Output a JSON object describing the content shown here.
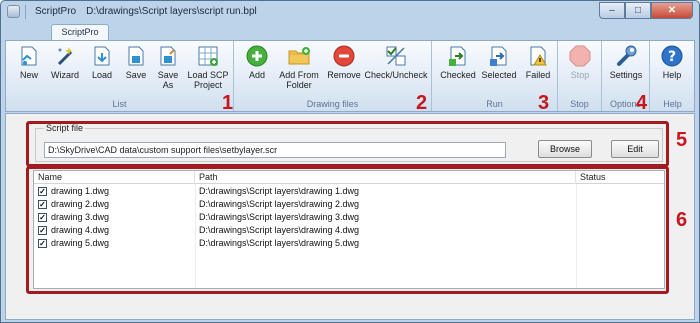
{
  "window": {
    "app_name": "ScriptPro",
    "file_path": "D:\\drawings\\Script layers\\script run.bpl",
    "minimize_glyph": "–",
    "maximize_glyph": "□",
    "close_glyph": "✕"
  },
  "ribbon": {
    "tab_label": "ScriptPro",
    "groups": {
      "list": {
        "label": "List",
        "buttons": {
          "new": "New",
          "wizard": "Wizard",
          "load": "Load",
          "save": "Save",
          "save_as_1": "Save",
          "save_as_2": "As",
          "load_scp_1": "Load SCP",
          "load_scp_2": "Project"
        }
      },
      "drawing_files": {
        "label": "Drawing files",
        "buttons": {
          "add": "Add",
          "add_from_folder_1": "Add From",
          "add_from_folder_2": "Folder",
          "remove": "Remove",
          "check_uncheck": "Check/Uncheck"
        }
      },
      "run": {
        "label": "Run",
        "buttons": {
          "checked": "Checked",
          "selected": "Selected",
          "failed": "Failed"
        }
      },
      "stop": {
        "label": "Stop",
        "buttons": {
          "stop": "Stop"
        }
      },
      "options": {
        "label": "Options",
        "buttons": {
          "settings": "Settings"
        }
      },
      "help": {
        "label": "Help",
        "buttons": {
          "help": "Help"
        }
      }
    }
  },
  "annotations": {
    "n1": "1",
    "n2": "2",
    "n3": "3",
    "n4": "4",
    "n5": "5",
    "n6": "6"
  },
  "script_file": {
    "legend": "Script file",
    "value": "D:\\SkyDrive\\CAD data\\custom support files\\setbylayer.scr",
    "browse_label": "Browse",
    "edit_label": "Edit"
  },
  "files_table": {
    "headers": {
      "name": "Name",
      "path": "Path",
      "status": "Status"
    },
    "rows": [
      {
        "checked": true,
        "name": "drawing 1.dwg",
        "path": "D:\\drawings\\Script layers\\drawing 1.dwg",
        "status": ""
      },
      {
        "checked": true,
        "name": "drawing 2.dwg",
        "path": "D:\\drawings\\Script layers\\drawing 2.dwg",
        "status": ""
      },
      {
        "checked": true,
        "name": "drawing 3.dwg",
        "path": "D:\\drawings\\Script layers\\drawing 3.dwg",
        "status": ""
      },
      {
        "checked": true,
        "name": "drawing 4.dwg",
        "path": "D:\\drawings\\Script layers\\drawing 4.dwg",
        "status": ""
      },
      {
        "checked": true,
        "name": "drawing 5.dwg",
        "path": "D:\\drawings\\Script layers\\drawing 5.dwg",
        "status": ""
      }
    ],
    "check_glyph": "✓"
  },
  "colors": {
    "annotation_red": "#a31b1e",
    "ribbon_label": "#5b7597"
  }
}
